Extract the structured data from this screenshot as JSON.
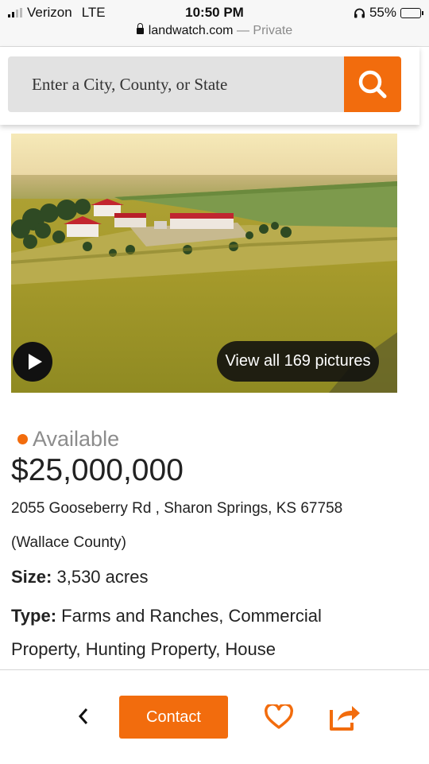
{
  "status_bar": {
    "carrier": "Verizon",
    "network": "LTE",
    "time": "10:50 PM",
    "battery": "55%",
    "url": "landwatch.com",
    "private_label": "— Private"
  },
  "search": {
    "placeholder": "Enter a City, County, or State",
    "button_icon": "search-icon",
    "accent_color": "#f26c0d"
  },
  "gallery": {
    "view_all_label": "View all 169 pictures",
    "play_icon": "play-icon"
  },
  "listing": {
    "status": "Available",
    "price": "$25,000,000",
    "address": "2055 Gooseberry Rd , Sharon Springs, KS 67758",
    "county": "(Wallace County)",
    "size_label": "Size:",
    "size_value": "3,530 acres",
    "type_label": "Type:",
    "type_value": "Farms and Ranches, Commercial Property, Hunting Property, House"
  },
  "bottom_bar": {
    "back_icon": "chevron-left-icon",
    "contact_label": "Contact",
    "favorite_icon": "heart-icon",
    "share_icon": "share-icon"
  }
}
